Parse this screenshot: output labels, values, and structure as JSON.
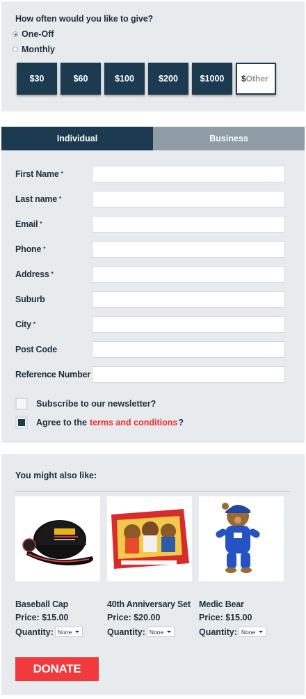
{
  "frequency": {
    "question": "How often would you like to give?",
    "options": [
      {
        "label": "One-Off",
        "selected": true
      },
      {
        "label": "Monthly",
        "selected": false
      }
    ]
  },
  "amounts": {
    "buttons": [
      "$30",
      "$60",
      "$100",
      "$200",
      "$1000"
    ],
    "other_currency": "$",
    "other_placeholder": "Other"
  },
  "tabs": [
    {
      "label": "Individual",
      "active": true
    },
    {
      "label": "Business",
      "active": false
    }
  ],
  "form": {
    "fields": [
      {
        "label": "First Name",
        "required": true,
        "value": ""
      },
      {
        "label": "Last name",
        "required": true,
        "value": ""
      },
      {
        "label": "Email",
        "required": true,
        "value": ""
      },
      {
        "label": "Phone",
        "required": true,
        "value": ""
      },
      {
        "label": "Address",
        "required": true,
        "value": ""
      },
      {
        "label": "Suburb",
        "required": false,
        "value": ""
      },
      {
        "label": "City",
        "required": true,
        "value": ""
      },
      {
        "label": "Post Code",
        "required": false,
        "value": ""
      },
      {
        "label": "Reference Number",
        "required": false,
        "value": ""
      }
    ],
    "required_marker": "*",
    "newsletter": {
      "label": "Subscribe to our newsletter?",
      "checked": false
    },
    "terms": {
      "prefix": "Agree to the",
      "link": "terms and conditions",
      "suffix": "?",
      "checked": true
    }
  },
  "suggestions": {
    "title": "You might also like:",
    "products": [
      {
        "name": "Baseball Cap",
        "price": "Price: $15.00",
        "qty_label": "Quantity:",
        "qty_value": "None"
      },
      {
        "name": "40th Anniversary Set",
        "price": "Price: $20.00",
        "qty_label": "Quantity:",
        "qty_value": "None"
      },
      {
        "name": "Medic Bear",
        "price": "Price: $15.00",
        "qty_label": "Quantity:",
        "qty_value": "None"
      }
    ]
  },
  "donate_label": "DONATE",
  "colors": {
    "navy": "#1c3a50",
    "accent_red": "#f03a3d",
    "link_red": "#ef2b2b",
    "panel_bg": "#e8ebee",
    "tab_inactive": "#8e9ca6"
  }
}
